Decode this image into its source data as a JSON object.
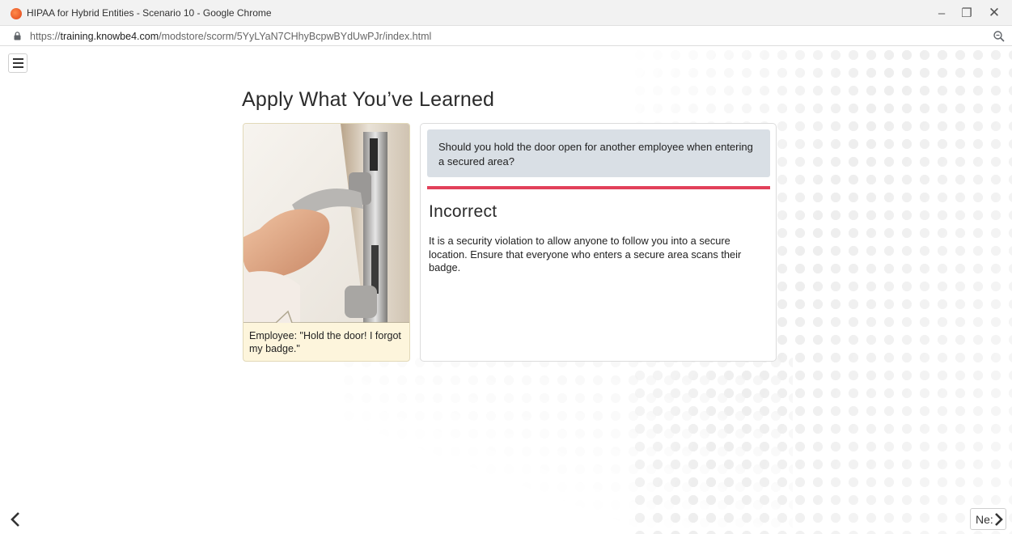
{
  "window": {
    "title": "HIPAA for Hybrid Entities - Scenario 10 - Google Chrome",
    "controls": {
      "minimize": "–",
      "maximize": "❐",
      "close": "✕"
    }
  },
  "urlbar": {
    "scheme": "https://",
    "host": "training.knowbe4.com",
    "path": "/modstore/scorm/5YyLYaN7CHhyBcpwBYdUwPJr/index.html"
  },
  "page": {
    "title": "Apply What You’ve Learned"
  },
  "scenario": {
    "caption": "Employee: \"Hold the door! I forgot my badge.\""
  },
  "feedback": {
    "question": "Should you hold the door open for another employee when entering a secured area?",
    "result_title": "Incorrect",
    "result_text": "It is a security violation to allow anyone to follow you into a secure location. Ensure that everyone who enters a secure area scans their badge.",
    "divider_color": "#e2405a"
  },
  "nav": {
    "next_label": "Ne:"
  },
  "icons": {
    "favicon": "knowbe4-favicon-icon",
    "lock": "lock-icon",
    "zoom": "zoom-icon",
    "menu": "hamburger-menu-icon",
    "prev": "chevron-left-icon",
    "next": "chevron-right-icon"
  }
}
